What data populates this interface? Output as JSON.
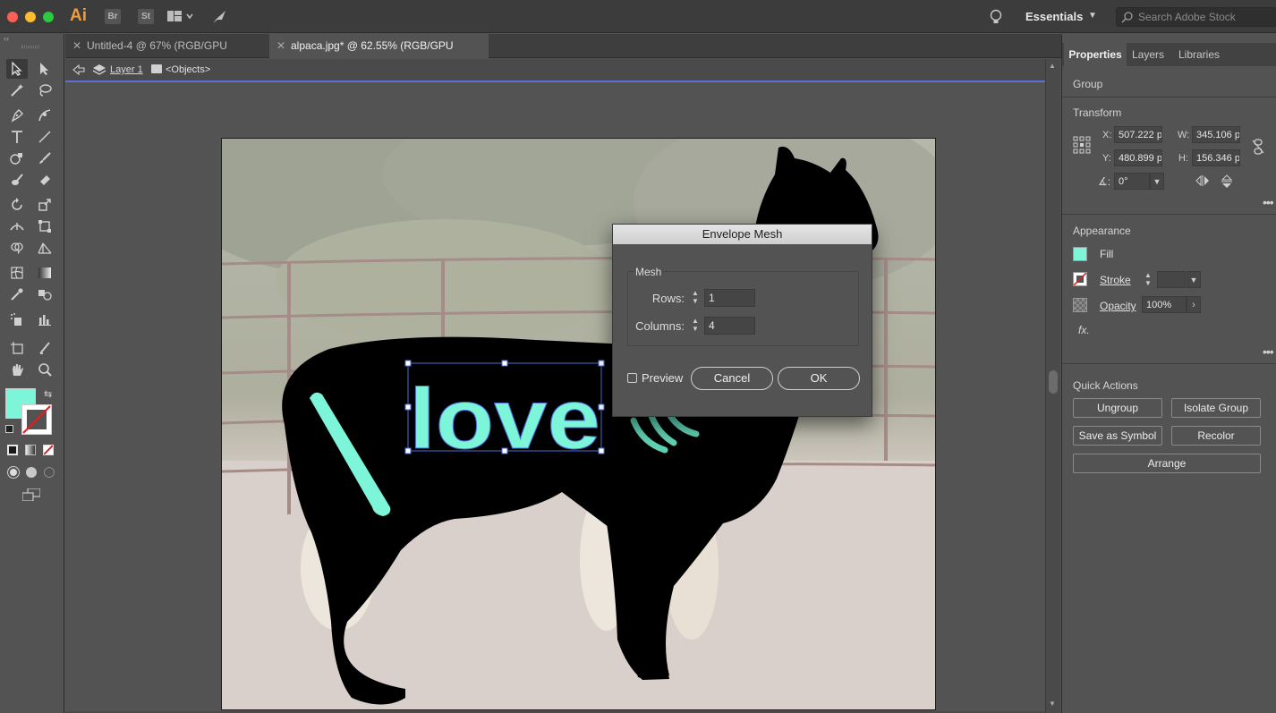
{
  "app": {
    "logo": "Ai",
    "bridge": "Br",
    "stock": "St",
    "workspace": "Essentials",
    "search_placeholder": "Search Adobe Stock"
  },
  "tabs": [
    {
      "label": "Untitled-4 @ 67% (RGB/GPU Preview)",
      "active": false
    },
    {
      "label": "alpaca.jpg* @ 62.55% (RGB/GPU Preview)",
      "active": true
    }
  ],
  "isolation": {
    "layer": "Layer 1",
    "objects": "<Objects>"
  },
  "artwork": {
    "text": "love",
    "text_color": "#7cf5d8",
    "silhouette_color": "#000000"
  },
  "dialog": {
    "title": "Envelope Mesh",
    "group_label": "Mesh",
    "rows_label": "Rows:",
    "rows_value": "1",
    "columns_label": "Columns:",
    "columns_value": "4",
    "preview_label": "Preview",
    "cancel_label": "Cancel",
    "ok_label": "OK"
  },
  "panel": {
    "tabs": [
      "Properties",
      "Layers",
      "Libraries"
    ],
    "selection_type": "Group",
    "transform_title": "Transform",
    "x_label": "X:",
    "x_value": "507.222 p",
    "y_label": "Y:",
    "y_value": "480.899 p",
    "w_label": "W:",
    "w_value": "345.106 p",
    "h_label": "H:",
    "h_value": "156.346 p",
    "angle_value": "0°",
    "appearance_title": "Appearance",
    "fill_label": "Fill",
    "fill_color": "#7cf5d8",
    "stroke_label": "Stroke",
    "opacity_label": "Opacity",
    "opacity_value": "100%",
    "fx_label": "fx.",
    "quick_actions_title": "Quick Actions",
    "buttons": {
      "ungroup": "Ungroup",
      "isolate": "Isolate Group",
      "save_symbol": "Save as Symbol",
      "recolor": "Recolor",
      "arrange": "Arrange"
    }
  }
}
